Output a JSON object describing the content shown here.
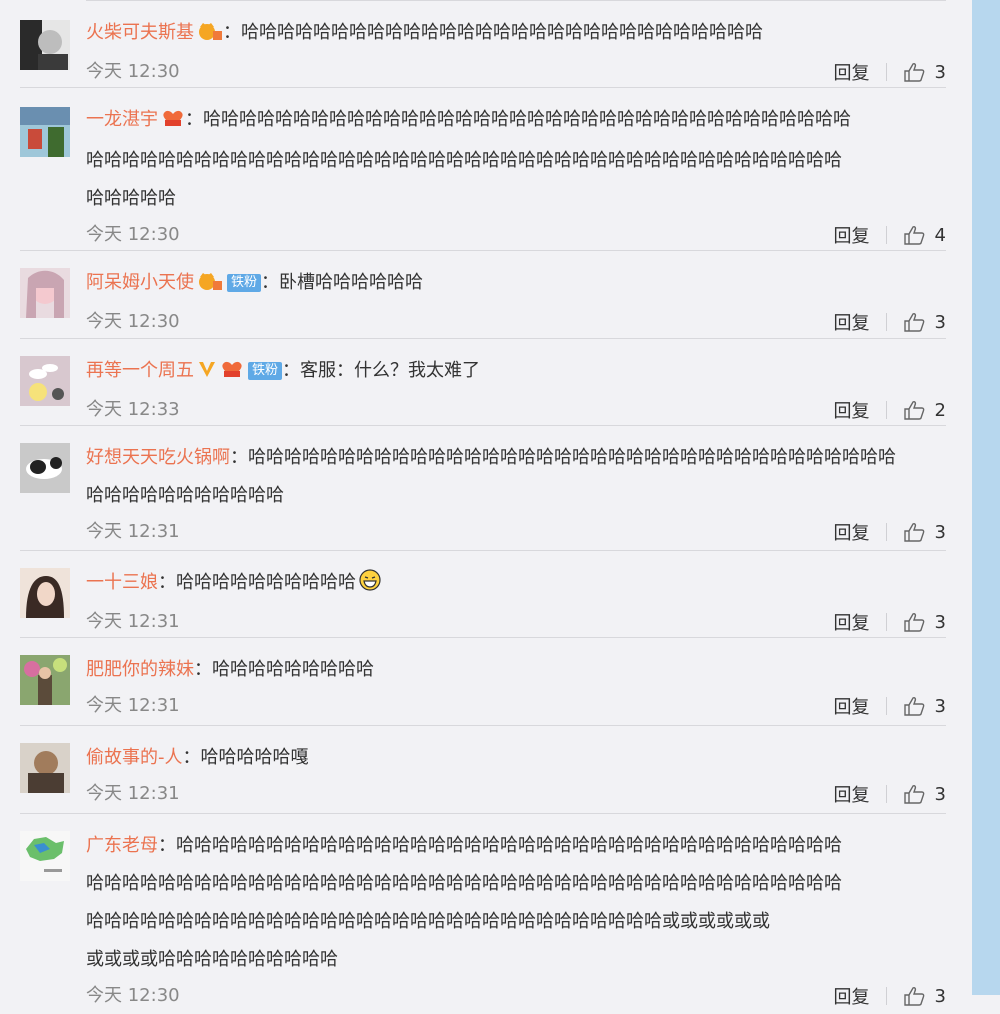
{
  "comments": [
    {
      "user": "火柴可夫斯基",
      "lines": [
        "：哈哈哈哈哈哈哈哈哈哈哈哈哈哈哈哈哈哈哈哈哈哈哈哈哈哈哈哈哈"
      ],
      "time": "今天 12:30",
      "reply": "回复",
      "likes": "3"
    },
    {
      "user": "一龙湛宇",
      "lines": [
        "：哈哈哈哈哈哈哈哈哈哈哈哈哈哈哈哈哈哈哈哈哈哈哈哈哈哈哈哈哈哈哈哈哈哈哈哈",
        "哈哈哈哈哈哈哈哈哈哈哈哈哈哈哈哈哈哈哈哈哈哈哈哈哈哈哈哈哈哈哈哈哈哈哈哈哈哈哈哈哈哈",
        "哈哈哈哈哈"
      ],
      "time": "今天 12:30",
      "reply": "回复",
      "likes": "4"
    },
    {
      "user": "阿呆姆小天使",
      "tag": "铁粉",
      "lines": [
        "：卧槽哈哈哈哈哈哈"
      ],
      "time": "今天 12:30",
      "reply": "回复",
      "likes": "3"
    },
    {
      "user": "再等一个周五",
      "tag": "铁粉",
      "lines": [
        "：客服：什么？我太难了"
      ],
      "time": "今天 12:33",
      "reply": "回复",
      "likes": "2"
    },
    {
      "user": "好想天天吃火锅啊",
      "lines": [
        "：哈哈哈哈哈哈哈哈哈哈哈哈哈哈哈哈哈哈哈哈哈哈哈哈哈哈哈哈哈哈哈哈哈哈哈哈",
        "哈哈哈哈哈哈哈哈哈哈哈"
      ],
      "time": "今天 12:31",
      "reply": "回复",
      "likes": "3"
    },
    {
      "user": "一十三娘",
      "lines": [
        "：哈哈哈哈哈哈哈哈哈哈"
      ],
      "time": "今天 12:31",
      "reply": "回复",
      "likes": "3"
    },
    {
      "user": "肥肥你的辣妹",
      "lines": [
        "：哈哈哈哈哈哈哈哈哈"
      ],
      "time": "今天 12:31",
      "reply": "回复",
      "likes": "3"
    },
    {
      "user": "偷故事的-人",
      "lines": [
        "：哈哈哈哈哈嘎"
      ],
      "time": "今天 12:31",
      "reply": "回复",
      "likes": "3"
    },
    {
      "user": "广东老母",
      "lines": [
        "：哈哈哈哈哈哈哈哈哈哈哈哈哈哈哈哈哈哈哈哈哈哈哈哈哈哈哈哈哈哈哈哈哈哈哈哈哈",
        "哈哈哈哈哈哈哈哈哈哈哈哈哈哈哈哈哈哈哈哈哈哈哈哈哈哈哈哈哈哈哈哈哈哈哈哈哈哈哈哈哈哈",
        "哈哈哈哈哈哈哈哈哈哈哈哈哈哈哈哈哈哈哈哈哈哈哈哈哈哈哈哈哈哈哈哈或或或或或或",
        "或或或或哈哈哈哈哈哈哈哈哈哈"
      ],
      "time": "今天 12:30",
      "reply": "回复",
      "likes": "3"
    }
  ]
}
